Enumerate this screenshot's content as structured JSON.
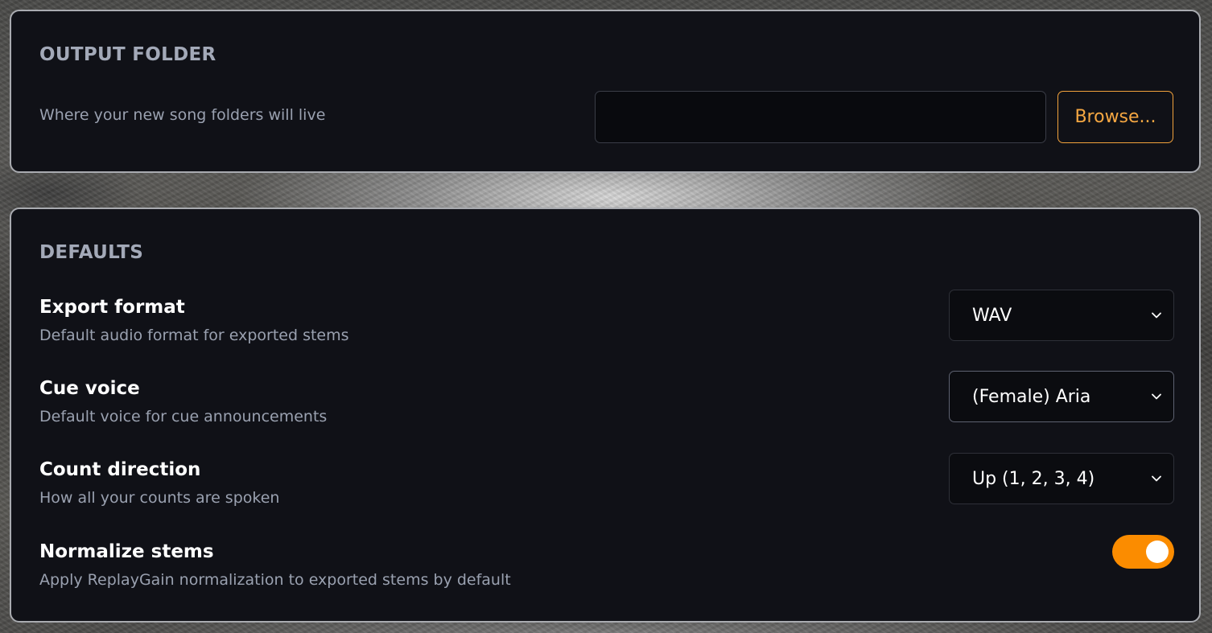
{
  "output_folder": {
    "title": "OUTPUT FOLDER",
    "description": "Where your new song folders will live",
    "path_value": "",
    "browse_label": "Browse..."
  },
  "defaults": {
    "title": "DEFAULTS",
    "export_format": {
      "label": "Export format",
      "description": "Default audio format for exported stems",
      "selected": "WAV"
    },
    "cue_voice": {
      "label": "Cue voice",
      "description": "Default voice for cue announcements",
      "selected": "(Female) Aria"
    },
    "count_direction": {
      "label": "Count direction",
      "description": "How all your counts are spoken",
      "selected": "Up (1, 2, 3, 4)"
    },
    "normalize_stems": {
      "label": "Normalize stems",
      "description": "Apply ReplayGain normalization to exported stems by default",
      "enabled": true
    }
  },
  "colors": {
    "card_bg": "#101117",
    "accent": "#fb8c00",
    "browse_accent": "#f5a742",
    "muted_text": "#9aa1b0"
  },
  "icons": {
    "dropdown": "chevron-down-icon"
  }
}
